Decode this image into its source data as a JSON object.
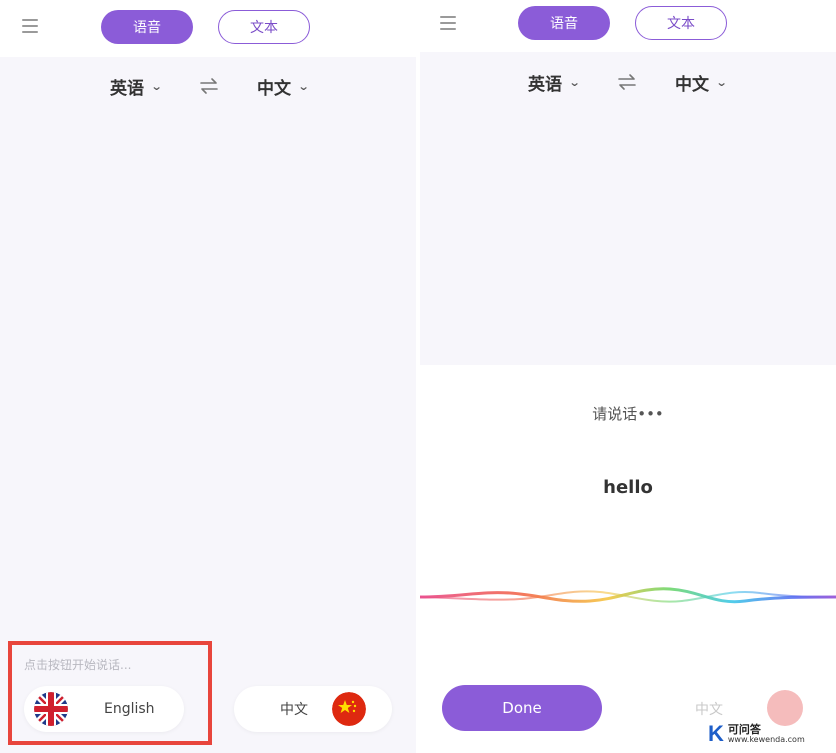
{
  "left_screen": {
    "tabs": {
      "voice": "语音",
      "text": "文本"
    },
    "source_language": "英语",
    "target_language": "中文",
    "hint": "点击按钮开始说话...",
    "english_button": "English",
    "chinese_button": "中文"
  },
  "right_screen": {
    "tabs": {
      "voice": "语音",
      "text": "文本"
    },
    "source_language": "英语",
    "target_language": "中文",
    "prompt": "请说话•••",
    "recognized": "hello",
    "done_button": "Done",
    "chinese_button": "中文"
  },
  "watermark": {
    "brand_letter": "K",
    "name": "可问答",
    "url": "www.kewenda.com"
  },
  "colors": {
    "accent": "#8b5cd8",
    "highlight": "#e8453c",
    "background": "#f7f6fb"
  },
  "icons": {
    "menu": "hamburger-menu-icon",
    "swap": "swap-arrows-icon",
    "chevron": "chevron-down-icon",
    "uk_flag": "uk-flag-icon",
    "china_flag": "china-flag-icon"
  }
}
